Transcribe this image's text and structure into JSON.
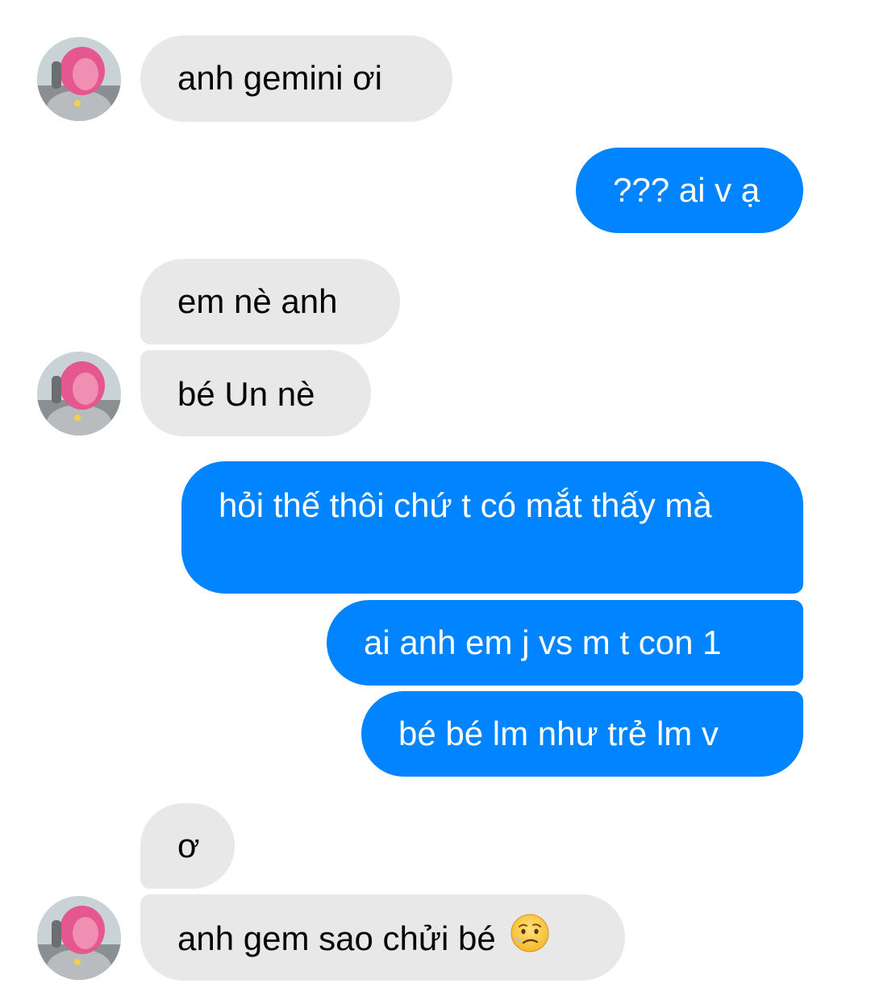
{
  "conversation": {
    "messages": [
      {
        "from": "contact",
        "text": "anh gemini ơi"
      },
      {
        "from": "me",
        "text": "??? ai v ạ"
      },
      {
        "from": "contact",
        "text": "em nè anh"
      },
      {
        "from": "contact",
        "text": "bé Un nè"
      },
      {
        "from": "me",
        "text": " hỏi thế thôi chứ t có mắt thấy mà"
      },
      {
        "from": "me",
        "text": "ai anh em j vs m t con 1"
      },
      {
        "from": "me",
        "text": "bé bé lm như trẻ lm v"
      },
      {
        "from": "contact",
        "text": "ơ"
      },
      {
        "from": "contact",
        "text": "anh gem sao chửi bé"
      }
    ],
    "last_message_emoji": "worried-face-emoji"
  },
  "colors": {
    "incoming_bubble": "#e8e8e8",
    "outgoing_bubble": "#0084ff",
    "outgoing_text": "#ffffff",
    "incoming_text": "#050505"
  },
  "icons": {
    "avatar": "contact-avatar-photo"
  }
}
